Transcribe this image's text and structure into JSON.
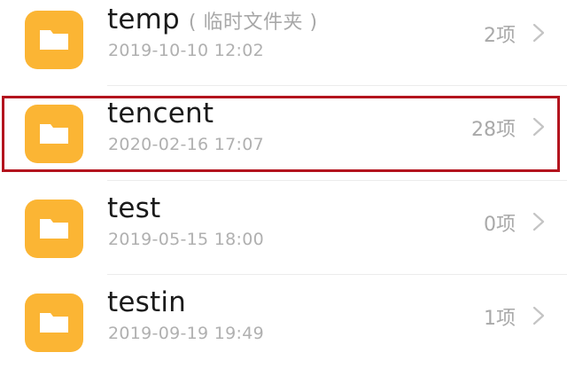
{
  "folders": [
    {
      "name": "temp",
      "note": "( 临时文件夹 )",
      "date": "2019-10-10 12:02",
      "count": "2项"
    },
    {
      "name": "tencent",
      "note": "",
      "date": "2020-02-16 17:07",
      "count": "28项"
    },
    {
      "name": "test",
      "note": "",
      "date": "2019-05-15 18:00",
      "count": "0项"
    },
    {
      "name": "testin",
      "note": "",
      "date": "2019-09-19 19:49",
      "count": "1项"
    }
  ],
  "colors": {
    "folder": "#FBB534",
    "folder_tab": "#FFFFFF",
    "highlight": "#B3141E"
  },
  "icons": {
    "folder": "folder-icon",
    "chevron": "chevron-right-icon"
  }
}
